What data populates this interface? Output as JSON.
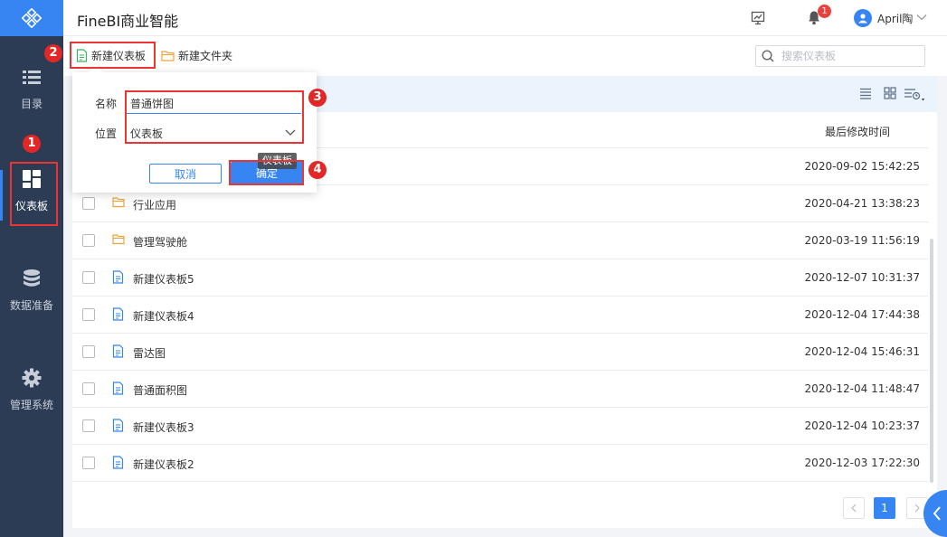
{
  "header": {
    "app_title": "FineBI商业智能",
    "notification_count": "1",
    "user_name": "April陶"
  },
  "sidebar": {
    "items": [
      {
        "label": "目录"
      },
      {
        "label": "仪表板"
      },
      {
        "label": "数据准备"
      },
      {
        "label": "管理系统"
      }
    ]
  },
  "toolbar": {
    "new_dashboard_label": "新建仪表板",
    "new_folder_label": "新建文件夹",
    "search_placeholder": "搜索仪表板"
  },
  "list": {
    "time_header": "最后修改时间",
    "rows": [
      {
        "name": "",
        "time": "2020-09-02 15:42:25",
        "icon": "folder-icon"
      },
      {
        "name": "行业应用",
        "time": "2020-04-21 13:38:23",
        "icon": "folder-icon"
      },
      {
        "name": "管理驾驶舱",
        "time": "2020-03-19 11:56:19",
        "icon": "folder-icon"
      },
      {
        "name": "新建仪表板5",
        "time": "2020-12-07 10:31:37",
        "icon": "dashboard-file-icon"
      },
      {
        "name": "新建仪表板4",
        "time": "2020-12-04 17:44:38",
        "icon": "dashboard-file-icon"
      },
      {
        "name": "雷达图",
        "time": "2020-12-04 15:46:31",
        "icon": "dashboard-file-icon"
      },
      {
        "name": "普通面积图",
        "time": "2020-12-04 11:48:47",
        "icon": "dashboard-file-icon"
      },
      {
        "name": "新建仪表板3",
        "time": "2020-12-04 10:23:37",
        "icon": "dashboard-file-icon"
      },
      {
        "name": "新建仪表板2",
        "time": "2020-12-03 17:22:30",
        "icon": "dashboard-file-icon"
      }
    ]
  },
  "pagination": {
    "current_page": "1"
  },
  "dialog": {
    "name_label": "名称",
    "name_value": "普通饼图",
    "location_label": "位置",
    "location_value": "仪表板",
    "cancel_label": "取消",
    "ok_label": "确定",
    "tooltip_text": "仪表板"
  },
  "annotations": {
    "steps": [
      "1",
      "2",
      "3",
      "4"
    ]
  },
  "colors": {
    "accent": "#3685f2",
    "sidebar_bg": "#2c3c55",
    "annotation_red": "#e33333"
  }
}
